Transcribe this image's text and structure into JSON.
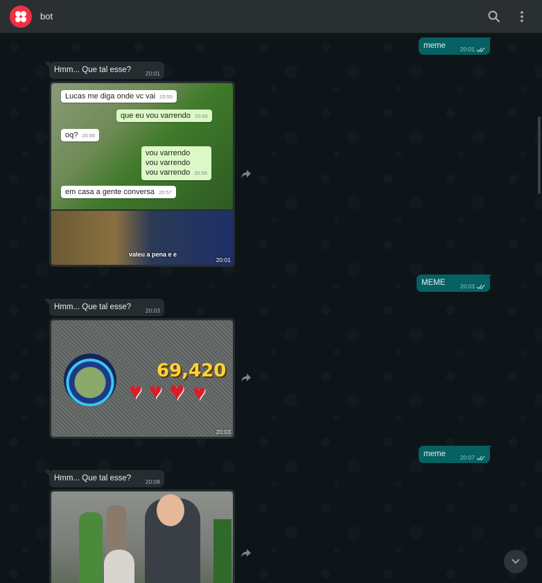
{
  "header": {
    "title": "bot",
    "avatar_icon": "twilio-logo-icon",
    "actions": [
      "search-icon",
      "more-vert-icon"
    ]
  },
  "colors": {
    "header_bg": "#2a2f32",
    "outgoing_bubble": "#056162",
    "incoming_bubble": "#262d31",
    "brand": "#f22f46"
  },
  "messages": [
    {
      "direction": "out",
      "text": "meme",
      "time": "20:01",
      "status": "read"
    },
    {
      "direction": "in",
      "text": "Hmm... Que tal esse?",
      "time": "20:01"
    },
    {
      "direction": "in",
      "type": "image",
      "time": "20:01",
      "embedded_chat": [
        {
          "text": "Lucas me diga onde vc vai",
          "time": "20:55"
        },
        {
          "text": "que eu vou varrendo",
          "time": "20:56"
        },
        {
          "text": "oq?",
          "time": "20:56"
        },
        {
          "text": "vou varrendo\nvou varrendo\nvou varrendo",
          "time": "20:56"
        },
        {
          "text": "em casa a gente conversa",
          "time": "20:57"
        }
      ],
      "caption": "valeu a pena e e"
    },
    {
      "direction": "out",
      "text": "MEME",
      "time": "20:03",
      "status": "read"
    },
    {
      "direction": "in",
      "text": "Hmm... Que tal esse?",
      "time": "20:03"
    },
    {
      "direction": "in",
      "type": "image",
      "time": "20:03",
      "score": "69,420"
    },
    {
      "direction": "out",
      "text": "meme",
      "time": "20:07",
      "status": "read"
    },
    {
      "direction": "in",
      "text": "Hmm... Que tal esse?",
      "time": "20:08"
    },
    {
      "direction": "in",
      "type": "image"
    }
  ],
  "controls": {
    "scroll_down_icon": "chevron-down-icon",
    "forward_icon": "forward-icon"
  }
}
